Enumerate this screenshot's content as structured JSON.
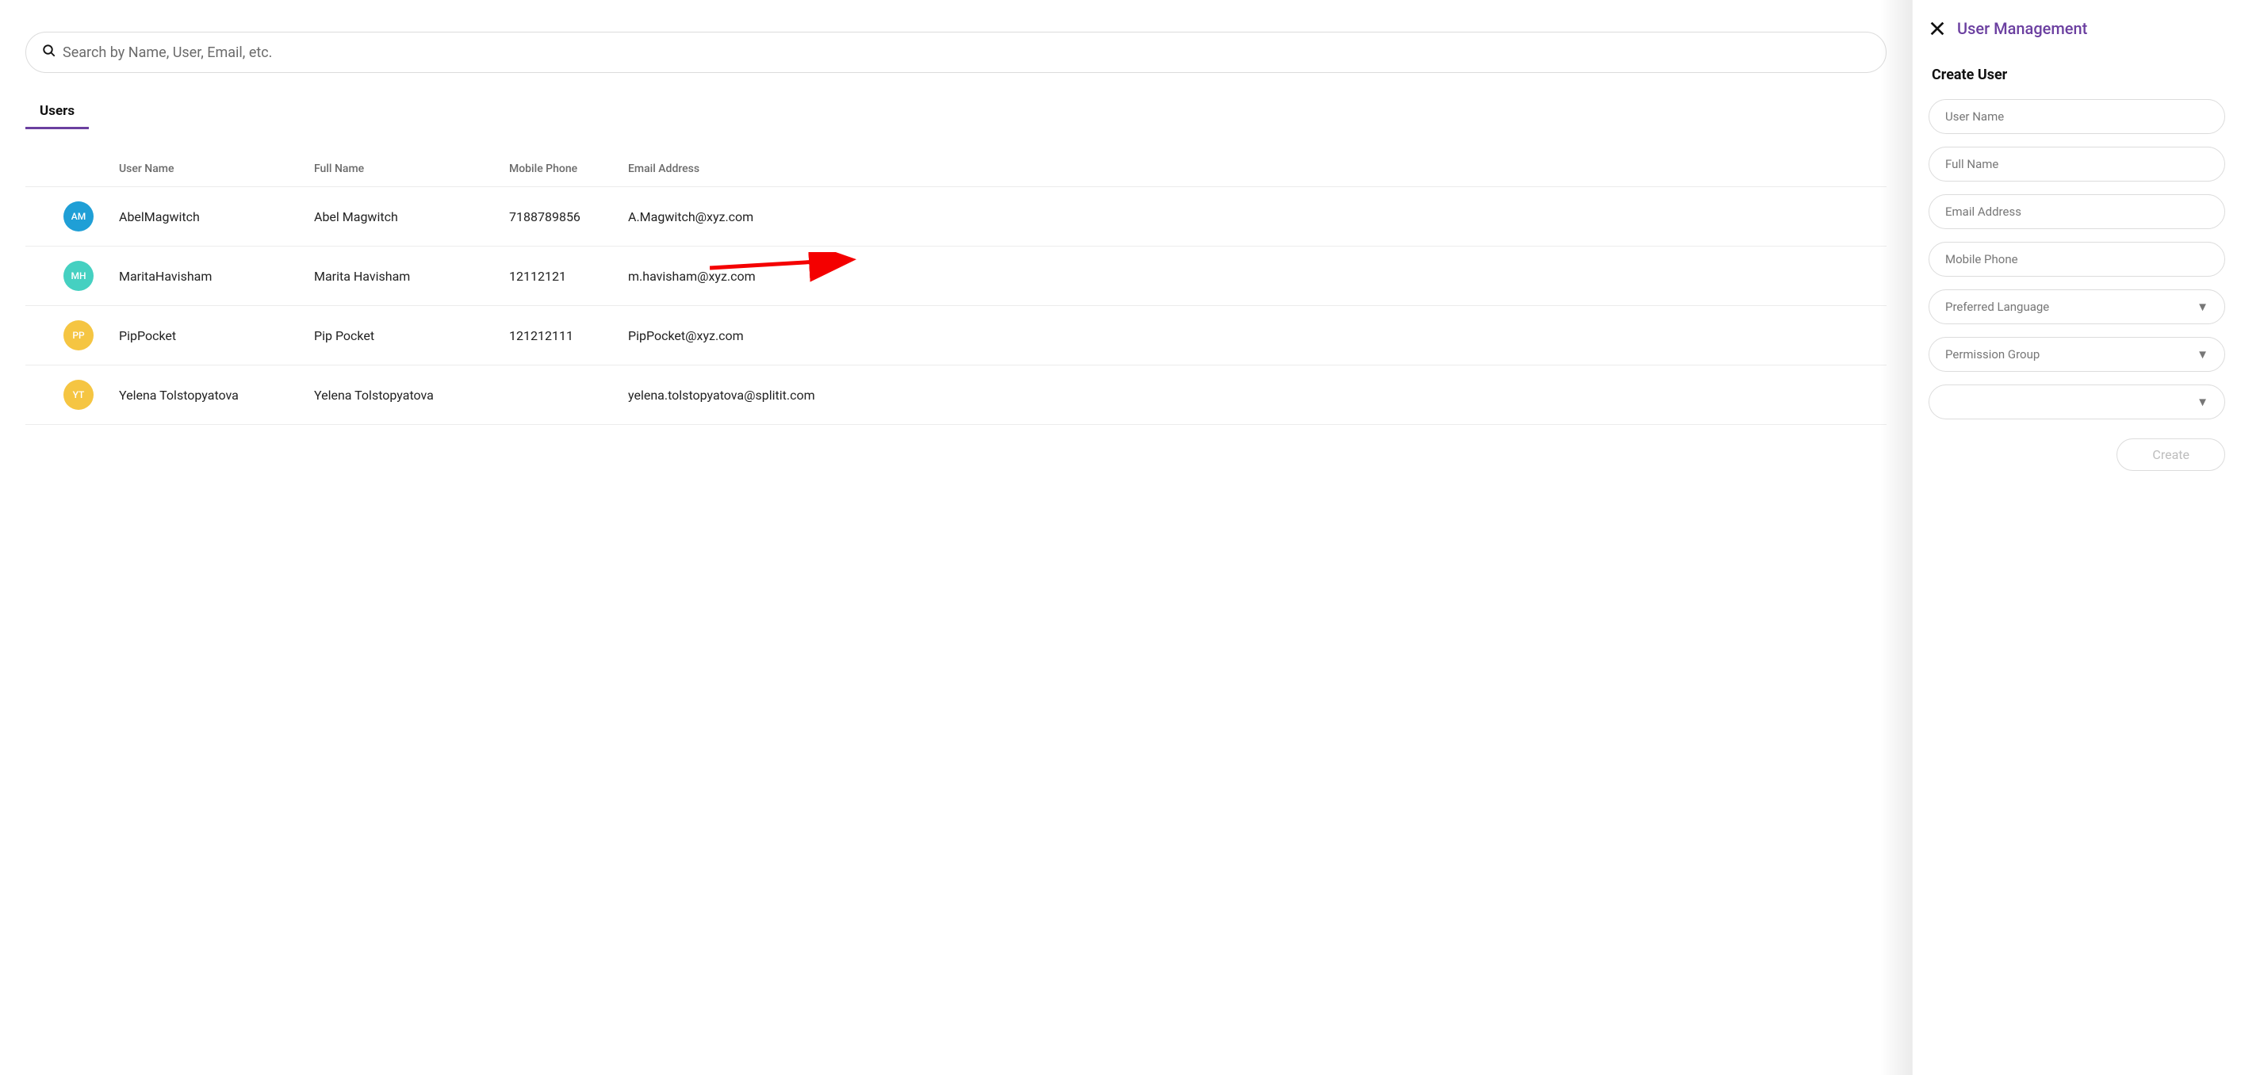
{
  "search": {
    "placeholder": "Search by Name, User, Email, etc."
  },
  "tabs": {
    "users": "Users"
  },
  "table": {
    "headers": {
      "user_name": "User Name",
      "full_name": "Full Name",
      "mobile": "Mobile Phone",
      "email": "Email Address"
    },
    "rows": [
      {
        "initials": "AM",
        "color": "#1F9FD6",
        "user_name": "AbelMagwitch",
        "full_name": "Abel Magwitch",
        "mobile": "7188789856",
        "email": "A.Magwitch@xyz.com"
      },
      {
        "initials": "MH",
        "color": "#45D0C1",
        "user_name": "MaritaHavisham",
        "full_name": "Marita Havisham",
        "mobile": "12112121",
        "email": "m.havisham@xyz.com"
      },
      {
        "initials": "PP",
        "color": "#F5C542",
        "user_name": "PipPocket",
        "full_name": "Pip Pocket",
        "mobile": "121212111",
        "email": "PipPocket@xyz.com"
      },
      {
        "initials": "YT",
        "color": "#F5C542",
        "user_name": "Yelena Tolstopyatova",
        "full_name": "Yelena Tolstopyatova",
        "mobile": "",
        "email": "yelena.tolstopyatova@splitit.com"
      }
    ]
  },
  "panel": {
    "title": "User Management",
    "form_title": "Create User",
    "user_name_ph": "User Name",
    "full_name_ph": "Full Name",
    "email_ph": "Email Address",
    "mobile_ph": "Mobile Phone",
    "lang_ph": "Preferred Language",
    "perm_ph": "Permission Group",
    "blank_ph": "",
    "create_label": "Create"
  }
}
